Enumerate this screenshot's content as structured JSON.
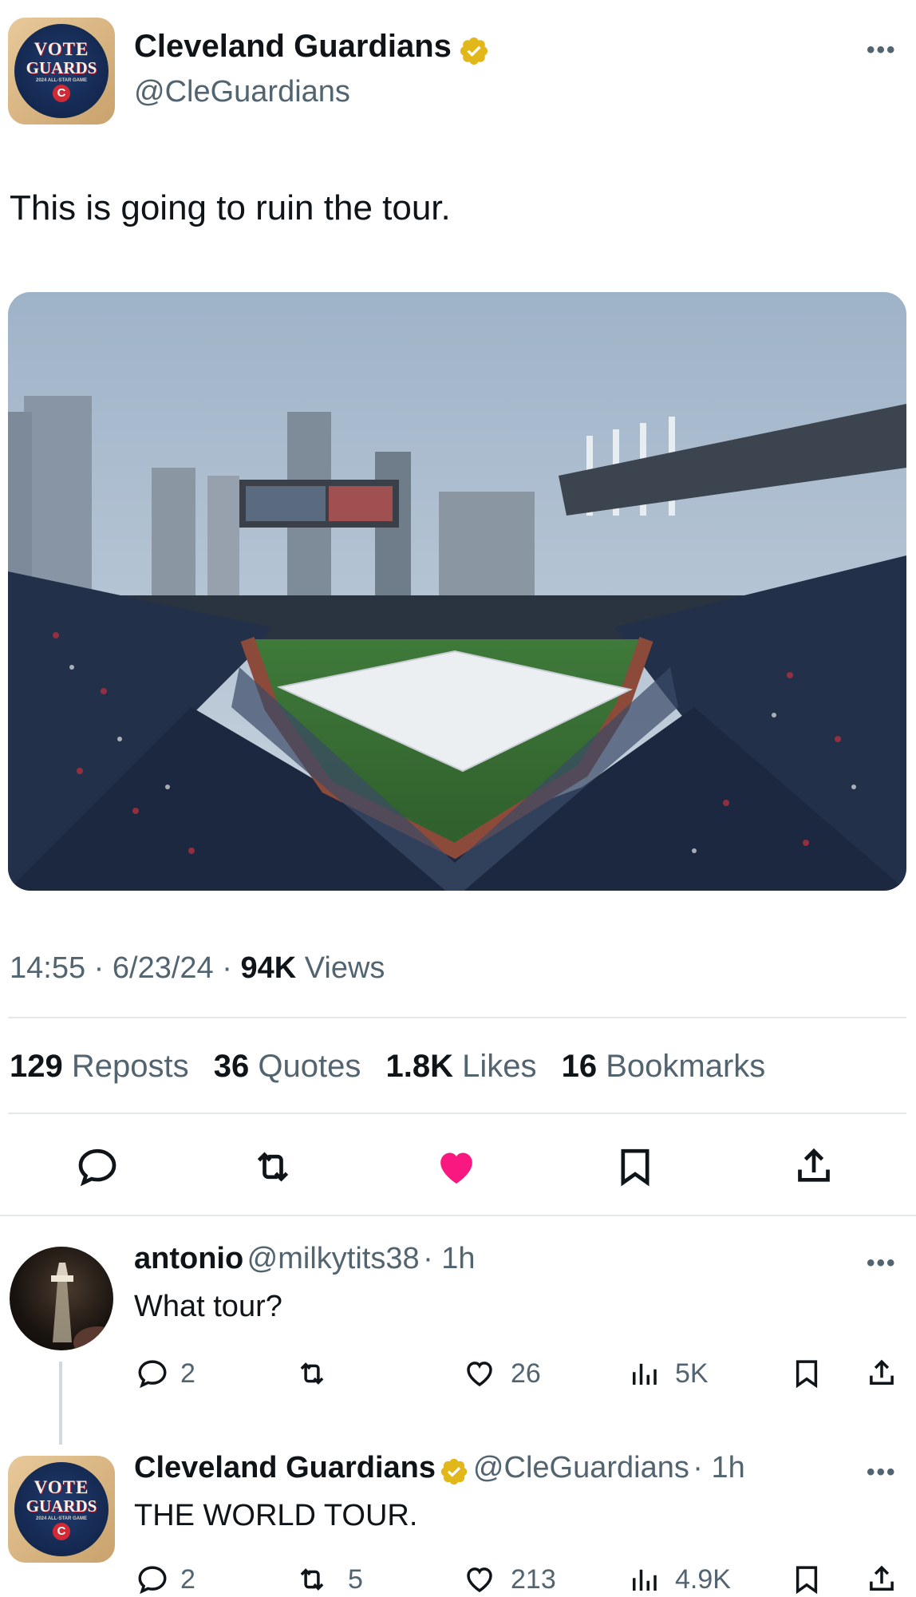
{
  "tweet": {
    "author_name": "Cleveland Guardians",
    "author_handle": "@CleGuardians",
    "avatar_text_1": "VOTE",
    "avatar_text_2": "GUARDS",
    "avatar_text_3": "2024 ALL-STAR GAME",
    "avatar_letter": "C",
    "text": "This is going to ruin the tour.",
    "time": "14:55",
    "date": "6/23/24",
    "views_count": "94K",
    "views_label": "Views",
    "stats": {
      "reposts_count": "129",
      "reposts_label": "Reposts",
      "quotes_count": "36",
      "quotes_label": "Quotes",
      "likes_count": "1.8K",
      "likes_label": "Likes",
      "bookmarks_count": "16",
      "bookmarks_label": "Bookmarks"
    },
    "more": "•••"
  },
  "replies": [
    {
      "name": "antonio",
      "handle": "@milkytits38",
      "time": "· 1h",
      "text": "What tour?",
      "replies": "2",
      "reposts": "",
      "likes": "26",
      "views": "5K"
    },
    {
      "name": "Cleveland Guardians",
      "handle": "@CleGuardians",
      "time": "· 1h",
      "text": "THE WORLD TOUR.",
      "replies": "2",
      "reposts": "5",
      "likes": "213",
      "views": "4.9K"
    }
  ],
  "colors": {
    "like_active": "#f91880",
    "verified_gold": "#e2b719",
    "text_secondary": "#536471"
  },
  "icons": [
    "reply-icon",
    "repost-icon",
    "like-icon",
    "bookmark-icon",
    "share-icon",
    "views-icon",
    "verified-badge-icon",
    "more-icon"
  ]
}
